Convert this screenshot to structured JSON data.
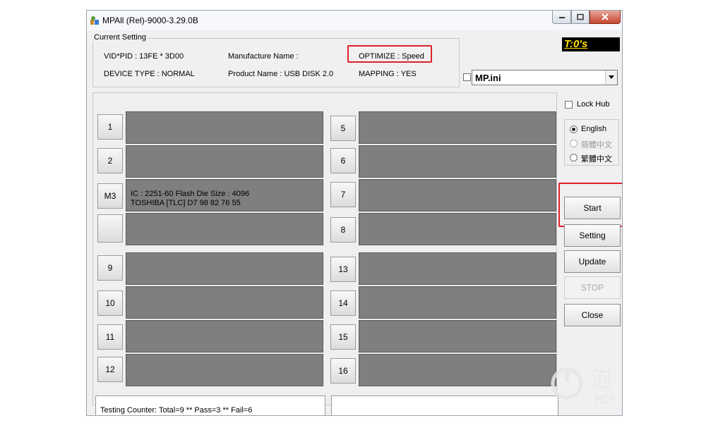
{
  "window": {
    "title": "MPAll (Rel)-9000-3.29.0B"
  },
  "current_setting": {
    "legend": "Current Setting",
    "vid_pid": "VID*PID : 13FE * 3D00",
    "device_type": "DEVICE TYPE : NORMAL",
    "manufacture_name": "Manufacture Name :",
    "product_name": "Product Name : USB DISK 2.0",
    "optimize": "OPTIMIZE : Speed",
    "mapping": "MAPPING : YES"
  },
  "timer": "T:0's",
  "ini": {
    "value": "MP.ini"
  },
  "ports": {
    "left": [
      {
        "label": "1",
        "info1": "",
        "info2": ""
      },
      {
        "label": "2",
        "info1": "",
        "info2": ""
      },
      {
        "label": "M3",
        "info1": "IC : 2251-60  Flash Die Size : 4096",
        "info2": "TOSHIBA [TLC] D7 98 82 76 55"
      },
      {
        "label": "",
        "info1": "",
        "info2": ""
      },
      {
        "label": "9",
        "info1": "",
        "info2": ""
      },
      {
        "label": "10",
        "info1": "",
        "info2": ""
      },
      {
        "label": "11",
        "info1": "",
        "info2": ""
      },
      {
        "label": "12",
        "info1": "",
        "info2": ""
      }
    ],
    "right": [
      {
        "label": "5"
      },
      {
        "label": "6"
      },
      {
        "label": "7"
      },
      {
        "label": "8"
      },
      {
        "label": "13"
      },
      {
        "label": "14"
      },
      {
        "label": "15"
      },
      {
        "label": "16"
      }
    ]
  },
  "lock_hub": "Lock Hub",
  "languages": {
    "english": "English",
    "simplified": "簡體中文",
    "traditional": "繁體中文",
    "selected": "English"
  },
  "buttons": {
    "start": "Start",
    "setting": "Setting",
    "update": "Update",
    "stop": "STOP",
    "close": "Close"
  },
  "status": {
    "counter": "Testing Counter: Total=9 ** Pass=3 ** Fail=6"
  },
  "watermark": {
    "text": "泡",
    "sub": "PCP"
  },
  "colors": {
    "highlight": "#e0202a",
    "slot": "#7f7f7f",
    "timer_bg": "#000000",
    "timer_fg": "#ffe000"
  }
}
